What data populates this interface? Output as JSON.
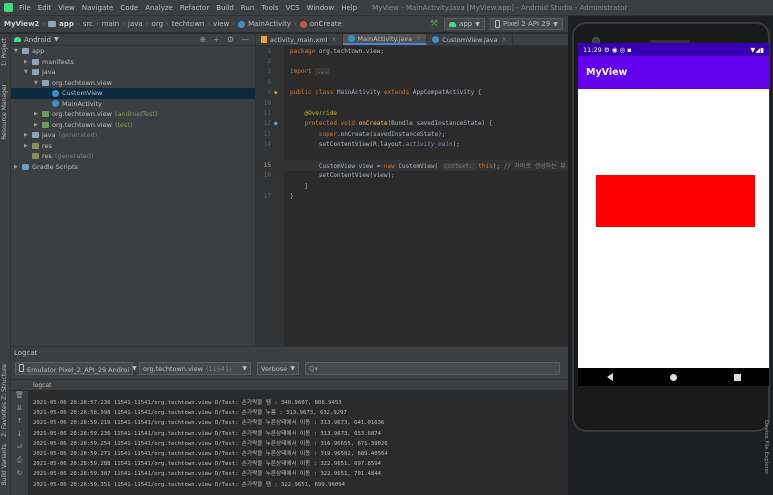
{
  "window": {
    "title": "MyView - MainActivity.java [MyView.app] - Android Studio - Administrator",
    "menu": [
      "File",
      "Edit",
      "View",
      "Navigate",
      "Code",
      "Analyze",
      "Refactor",
      "Build",
      "Run",
      "Tools",
      "VCS",
      "Window",
      "Help"
    ]
  },
  "breadcrumb": {
    "items": [
      "MyView2",
      "app",
      "src",
      "main",
      "java",
      "org",
      "techtown",
      "view",
      "MainActivity",
      "onCreate"
    ]
  },
  "toolbar": {
    "run_config": "app",
    "device": "Pixel 2 API 29"
  },
  "left_strip": {
    "tabs": [
      "1: Project",
      "Resource Manager",
      "Z: Structure",
      "2: Favorites",
      "Build Variants"
    ]
  },
  "project": {
    "view_mode": "Android",
    "tree": [
      {
        "label": "app",
        "extra": "",
        "indent": 0,
        "arrow": "▼",
        "icon": "folder",
        "selected": false
      },
      {
        "label": "manifests",
        "extra": "",
        "indent": 1,
        "arrow": "▶",
        "icon": "folder",
        "selected": false
      },
      {
        "label": "java",
        "extra": "",
        "indent": 1,
        "arrow": "▼",
        "icon": "folder",
        "selected": false
      },
      {
        "label": "org.techtown.view",
        "extra": "",
        "indent": 2,
        "arrow": "▼",
        "icon": "package",
        "selected": false
      },
      {
        "label": "CustomView",
        "extra": "",
        "indent": 3,
        "arrow": "",
        "icon": "class",
        "selected": true
      },
      {
        "label": "MainActivity",
        "extra": "",
        "indent": 3,
        "arrow": "",
        "icon": "class",
        "selected": false
      },
      {
        "label": "org.techtown.view",
        "extra": "(androidTest)",
        "indent": 2,
        "arrow": "▶",
        "icon": "package-green",
        "selected": false
      },
      {
        "label": "org.techtown.view",
        "extra": "(test)",
        "indent": 2,
        "arrow": "▶",
        "icon": "package-green",
        "selected": false
      },
      {
        "label": "java",
        "extra": "(generated)",
        "indent": 1,
        "arrow": "▶",
        "icon": "folder",
        "selected": false
      },
      {
        "label": "res",
        "extra": "",
        "indent": 1,
        "arrow": "▶",
        "icon": "res",
        "selected": false
      },
      {
        "label": "res",
        "extra": "(generated)",
        "indent": 1,
        "arrow": "",
        "icon": "res",
        "selected": false
      },
      {
        "label": "Gradle Scripts",
        "extra": "",
        "indent": 0,
        "arrow": "▶",
        "icon": "gradle",
        "selected": false
      }
    ]
  },
  "editor": {
    "tabs": [
      {
        "label": "activity_main.xml",
        "active": false,
        "icon": "xml"
      },
      {
        "label": "MainActivity.java",
        "active": true,
        "icon": "class"
      },
      {
        "label": "CustomView.java",
        "active": false,
        "icon": "class"
      }
    ],
    "line_numbers": [
      "1",
      "2",
      "3",
      "8",
      "9",
      "10",
      "11",
      "12",
      "13",
      "14",
      "15",
      "16",
      "17"
    ]
  },
  "logcat": {
    "title": "Logcat",
    "device": "Emulator Pixel_2_API_29 Androi",
    "process": "org.techtown.view",
    "process_pid": "(11541)",
    "level": "Verbose",
    "search_placeholder": "Q▾",
    "sub_label": "logcat",
    "lines": [
      "2021-05-06 20:28:57.236 11541-11541/org.techtown.view D/Test: 손가락을 땜 : 340.9607, 808.9453",
      "2021-05-06 20:28:58.998 11541-11541/org.techtown.view D/Test: 손가락을 누름 : 313.9673, 632.9297",
      "2021-05-06 20:28:59.219 11541-11541/org.techtown.view D/Test: 손가락을 누른상태에서 이동 : 313.9673, 641.01636",
      "2021-05-06 20:28:59.236 11541-11541/org.techtown.view D/Test: 손가락을 누른상태에서 이동 : 313.9673, 653.6874",
      "2021-05-06 20:28:59.254 11541-11541/org.techtown.view D/Test: 손가락을 누른상태에서 이동 : 316.96655, 671.39026",
      "2021-05-06 20:28:59.271 11541-11541/org.techtown.view D/Test: 손가락을 누른상태에서 이동 : 319.96582, 689.40564",
      "2021-05-06 20:28:59.288 11541-11541/org.techtown.view D/Test: 손가락을 누른상태에서 이동 : 322.9651, 697.8594",
      "2021-05-06 20:28:59.307 11541-11541/org.techtown.view D/Test: 손가락을 누른상태에서 이동 : 322.9651, 701.4844",
      "2021-05-06 20:28:59.351 11541-11541/org.techtown.view D/Test: 손가락을 땜 : 322.9651, 699.96094"
    ]
  },
  "phone": {
    "time": "11:29",
    "app_title": "MyView",
    "shape_color": "#ff0000"
  },
  "right_strip": {
    "label": "Device File Explorer"
  }
}
